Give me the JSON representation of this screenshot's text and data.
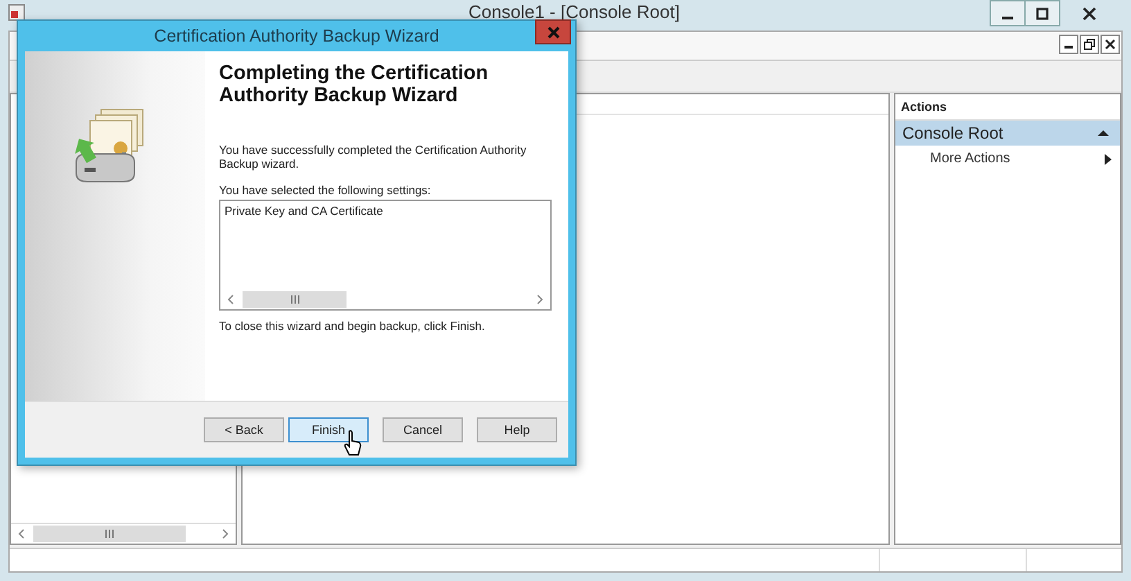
{
  "console": {
    "title": "Console1 - [Console Root]"
  },
  "actions": {
    "header": "Actions",
    "items": [
      {
        "kind": "group",
        "label": "Console Root",
        "expanded": true
      },
      {
        "kind": "action",
        "label": "More Actions"
      }
    ]
  },
  "dialog": {
    "title": "Certification Authority Backup Wizard",
    "heading": "Completing the Certification Authority Backup Wizard",
    "intro": "You have successfully completed the Certification Authority Backup wizard.",
    "settings_label": "You have selected the following settings:",
    "settings": [
      "Private Key and CA Certificate"
    ],
    "closing": "To close this wizard and begin backup, click Finish.",
    "buttons": [
      {
        "label": "< Back",
        "focused": false
      },
      {
        "label": "Finish",
        "focused": true
      },
      {
        "label": "Cancel",
        "focused": false
      },
      {
        "label": "Help",
        "focused": false
      }
    ]
  }
}
